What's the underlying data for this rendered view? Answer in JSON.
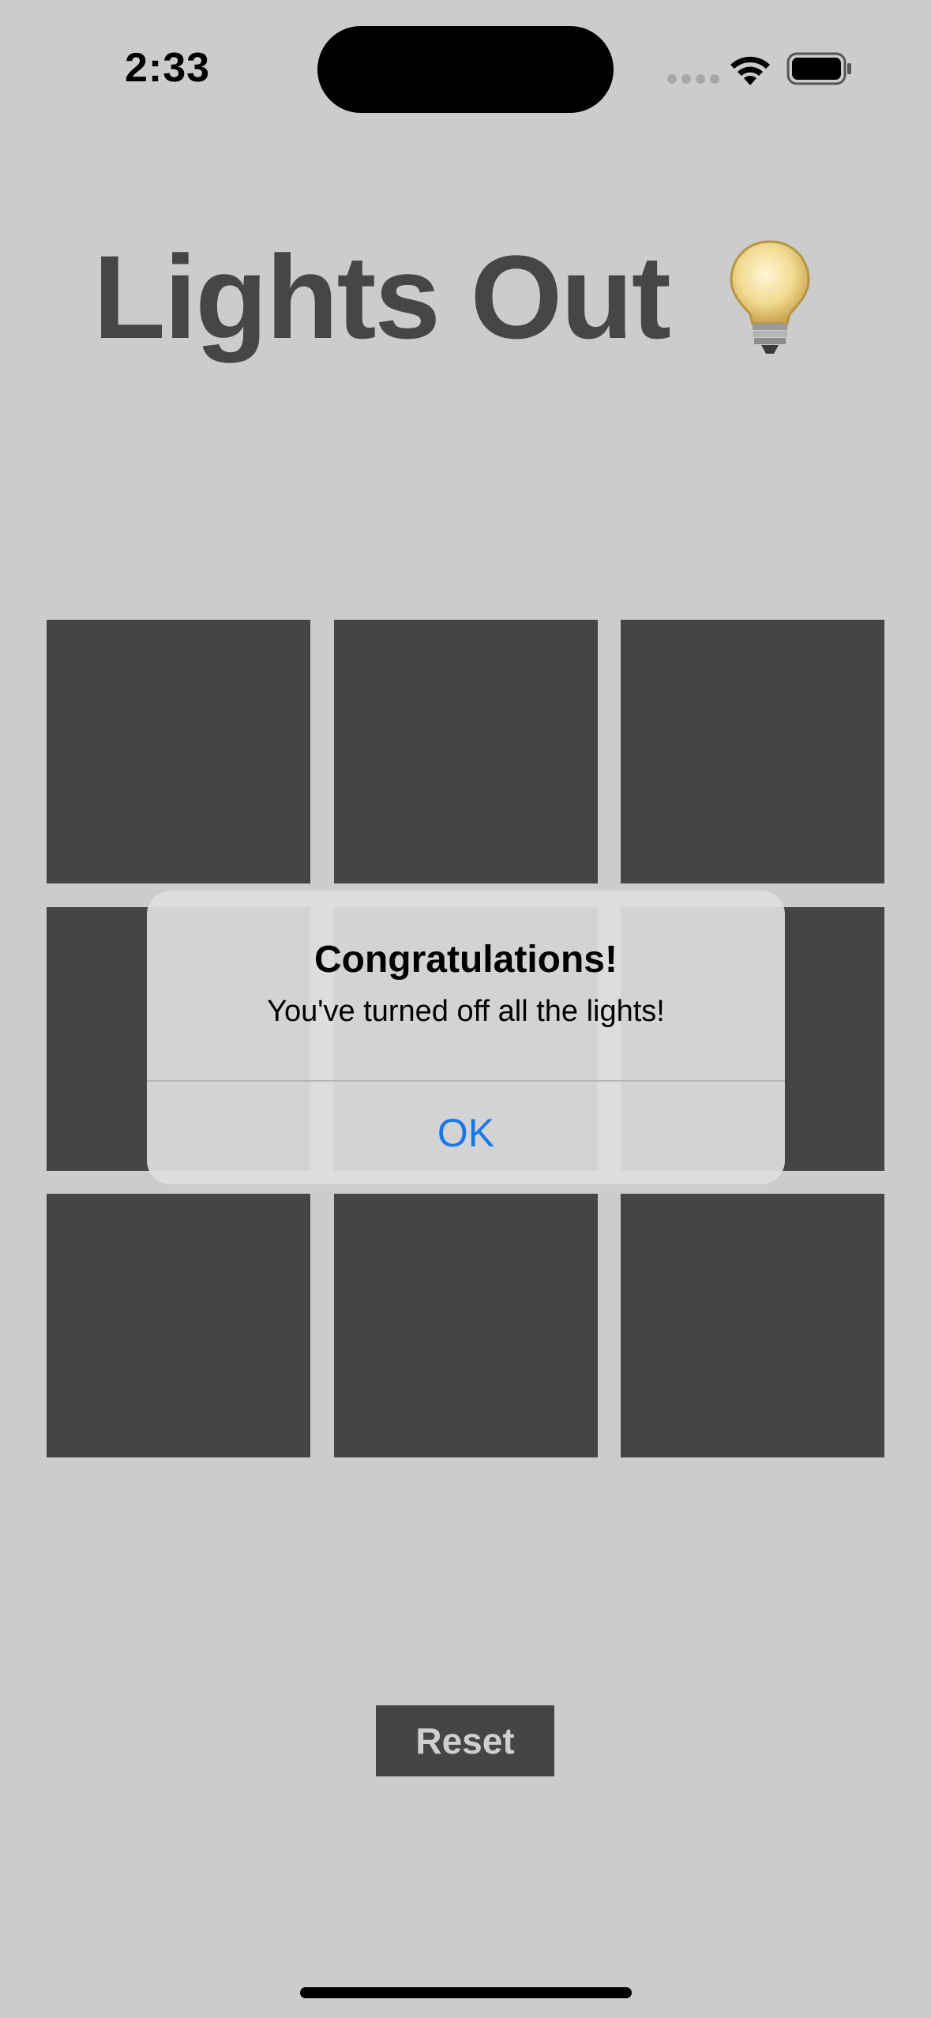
{
  "status_bar": {
    "time": "2:33",
    "icons": [
      "cellular-signal-icon",
      "wifi-icon",
      "battery-icon"
    ]
  },
  "app": {
    "title": "Lights Out",
    "title_icon": "lightbulb-icon"
  },
  "board": {
    "rows": 3,
    "cols": 3,
    "tiles": [
      {
        "row": 1,
        "col": 1,
        "lit": false
      },
      {
        "row": 1,
        "col": 2,
        "lit": false
      },
      {
        "row": 1,
        "col": 3,
        "lit": false
      },
      {
        "row": 2,
        "col": 1,
        "lit": false
      },
      {
        "row": 2,
        "col": 2,
        "lit": false
      },
      {
        "row": 2,
        "col": 3,
        "lit": false
      },
      {
        "row": 3,
        "col": 1,
        "lit": false
      },
      {
        "row": 3,
        "col": 2,
        "lit": false
      },
      {
        "row": 3,
        "col": 3,
        "lit": false
      }
    ],
    "tile_color": "#454545"
  },
  "alert": {
    "title": "Congratulations!",
    "message": "You've turned off all the lights!",
    "ok_label": "OK",
    "button_color": "#1878e8"
  },
  "controls": {
    "reset_label": "Reset"
  },
  "colors": {
    "background": "#cccccc",
    "title": "#464646"
  }
}
